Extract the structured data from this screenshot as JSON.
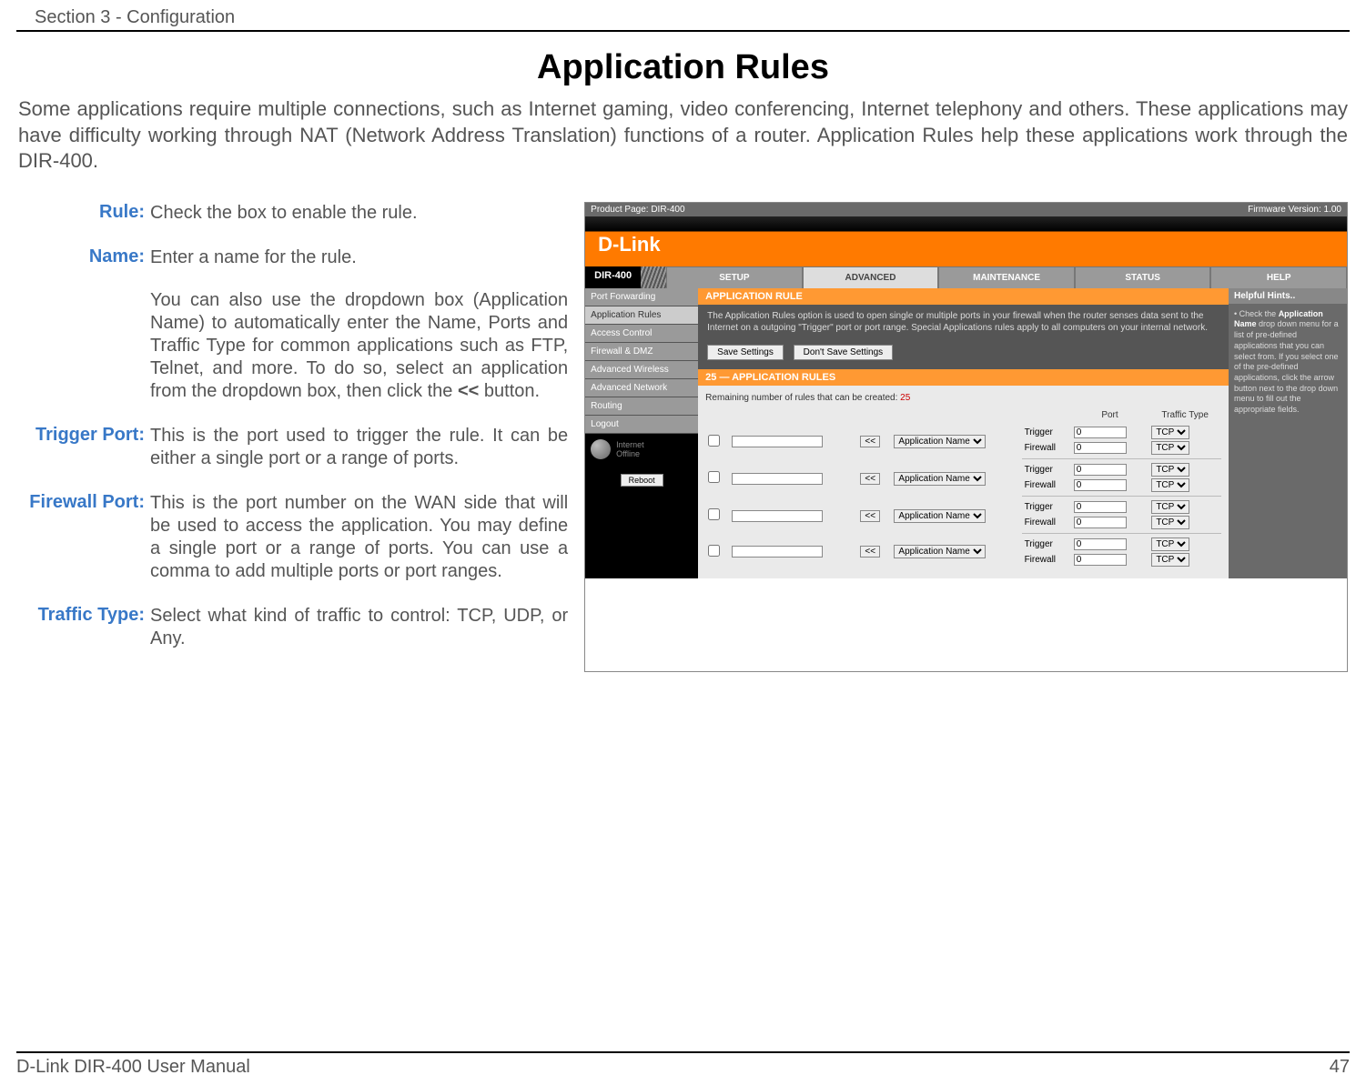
{
  "header": {
    "section": "Section 3 - Configuration"
  },
  "title": "Application Rules",
  "intro": "Some applications require multiple connections, such as Internet gaming, video conferencing, Internet telephony and others. These applications may have difficulty working through NAT (Network Address Translation) functions of a router. Application Rules help these applications work through the DIR-400.",
  "defs": {
    "rule": {
      "label": "Rule:",
      "text": "Check the box to enable the rule."
    },
    "name": {
      "label": "Name:",
      "p1": "Enter a name for the rule.",
      "p2a": "You can also use the dropdown box (Application Name) to automatically enter the Name, Ports and Traffic Type for common applications such as FTP, Telnet, and more.  To do so, select an application from the dropdown box, then click the ",
      "p2bold": "<<",
      "p2b": " button."
    },
    "trigger": {
      "label": "Trigger Port:",
      "text": "This is the port used to trigger the rule. It can be either a single port or a range of ports."
    },
    "firewall": {
      "label": "Firewall Port:",
      "text": "This is the port number on the WAN side that will be used to access the application. You may define a single port or a range of ports. You can use a comma to add multiple ports or port ranges."
    },
    "traffic": {
      "label": "Traffic Type:",
      "text": "Select what kind of traffic to control: TCP, UDP, or Any."
    }
  },
  "ui": {
    "topbar": {
      "left": "Product Page:",
      "model": "DIR-400",
      "right": "Firmware Version: 1.00"
    },
    "brand": "D-Link",
    "model_tab": "DIR-400",
    "tabs": [
      "SETUP",
      "ADVANCED",
      "MAINTENANCE",
      "STATUS",
      "HELP"
    ],
    "active_tab": 1,
    "sidenav": [
      "Port Forwarding",
      "Application Rules",
      "Access Control",
      "Firewall & DMZ",
      "Advanced Wireless",
      "Advanced Network",
      "Routing",
      "Logout"
    ],
    "active_side": 1,
    "status": {
      "line1": "Internet",
      "line2": "Offline"
    },
    "reboot": "Reboot",
    "panel": {
      "title": "APPLICATION RULE",
      "desc": "The Application Rules option is used to open single or multiple ports in your firewall when the router senses data sent to the Internet on a outgoing \"Trigger\" port or port range. Special Applications rules apply to all computers on your internal network.",
      "save": "Save Settings",
      "dont_save": "Don't Save Settings"
    },
    "rules": {
      "title": "25 — APPLICATION RULES",
      "remaining_label": "Remaining number of rules that can be created: ",
      "remaining_count": "25",
      "col_port": "Port",
      "col_type": "Traffic Type",
      "arrow": "<<",
      "appname": "Application Name",
      "trigger": "Trigger",
      "firewall": "Firewall",
      "port_default": "0",
      "tcp": "TCP"
    },
    "hints": {
      "title": "Helpful Hints..",
      "bold": "Application Name",
      "pre": "• Check the ",
      "post": " drop down menu for a list of pre-defined applications that you can select from. If you select one of the pre-defined applications, click the arrow button next to the drop down menu to fill out the appropriate fields."
    }
  },
  "footer": {
    "left": "D-Link DIR-400 User Manual",
    "right": "47"
  }
}
